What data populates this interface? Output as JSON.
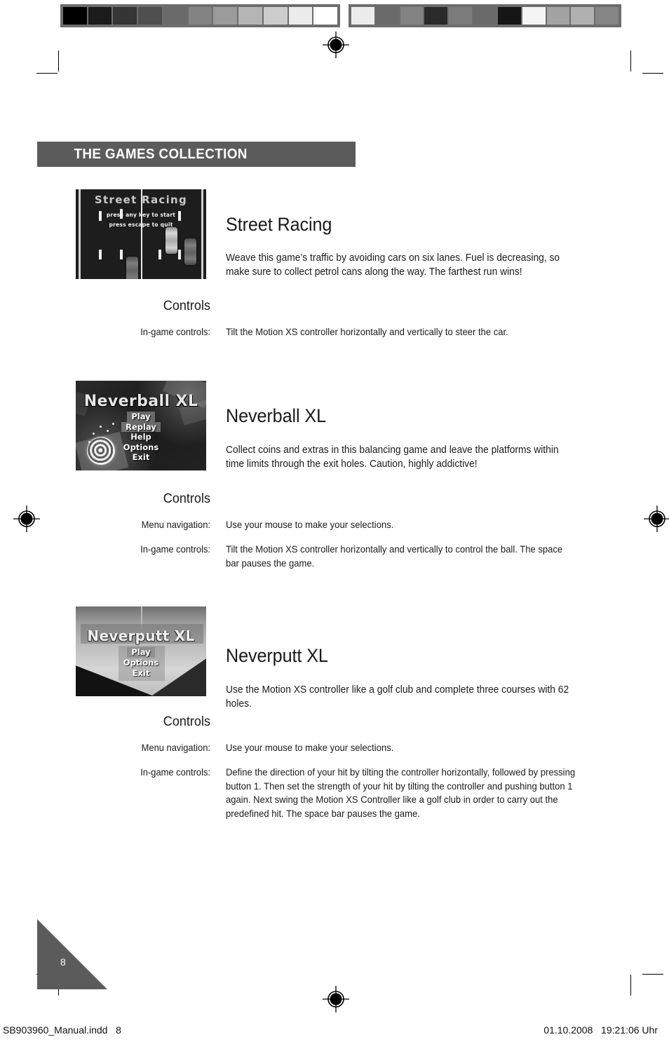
{
  "document": {
    "section_header": "THE GAMES COLLECTION",
    "page_number": "8",
    "imprint_left": "SB903960_Manual.indd   8",
    "imprint_right": "01.10.2008   19:21:06 Uhr"
  },
  "colors": {
    "band_gray": "#5b5b5b",
    "text_black": "#1a1a1a",
    "page_white": "#ffffff"
  },
  "calibration": {
    "left_swatches": [
      "#000000",
      "#1b1b1b",
      "#353535",
      "#4f4f4f",
      "#6a6a6a",
      "#838383",
      "#9b9b9b",
      "#b4b4b4",
      "#cccccc",
      "#ececec",
      "#ffffff"
    ],
    "right_swatches": [
      "#ececec",
      "#6a6a6a",
      "#838383",
      "#2a2a2a",
      "#7c7c7c",
      "#6a6a6a",
      "#161616",
      "#f4f4f4",
      "#a3a3a3",
      "#b0b0b0",
      "#858585"
    ]
  },
  "games": [
    {
      "title": "Street Racing",
      "description": "Weave this game’s traffic by avoiding cars on six lanes. Fuel is decreasing, so make sure to collect petrol cans along the way. The farthest run wins!",
      "controls_heading": "Controls",
      "controls": [
        {
          "label": "In-game controls:",
          "value": "Tilt the Motion XS controller horizontally and vertically to steer the car."
        }
      ],
      "screenshot": {
        "title": "Street Racing",
        "line1": "press any key to start",
        "line2": "press escape to quit"
      }
    },
    {
      "title": "Neverball XL",
      "description": "Collect coins and extras in this balancing game and leave the platforms within time limits through the exit holes. Caution, highly addictive!",
      "controls_heading": "Controls",
      "controls": [
        {
          "label": "Menu navigation:",
          "value": "Use your mouse to make your selections."
        },
        {
          "label": "In-game controls:",
          "value": "Tilt the Motion XS controller horizontally and vertically to control the ball. The space bar pauses the game."
        }
      ],
      "screenshot": {
        "title": "Neverball XL",
        "menu": [
          "Play",
          "Replay",
          "Help",
          "Options",
          "Exit"
        ],
        "highlighted": "Replay"
      }
    },
    {
      "title": "Neverputt XL",
      "description": "Use the Motion XS controller like a golf club and complete three courses with 62 holes.",
      "controls_heading": "Controls",
      "controls": [
        {
          "label": "Menu navigation:",
          "value": "Use your mouse to make your selections."
        },
        {
          "label": "In-game controls:",
          "value": "Define the direction of your hit by tilting the controller horizontally, followed by pressing button 1. Then set the strength of your hit by tilting the controller and pushing button 1 again. Next swing the Motion XS Controller like a golf club in order to carry out the predefined hit. The space bar pauses the game."
        }
      ],
      "screenshot": {
        "title": "Neverputt XL",
        "menu": [
          "Play",
          "Options",
          "Exit"
        ],
        "highlighted": "Play"
      }
    }
  ]
}
